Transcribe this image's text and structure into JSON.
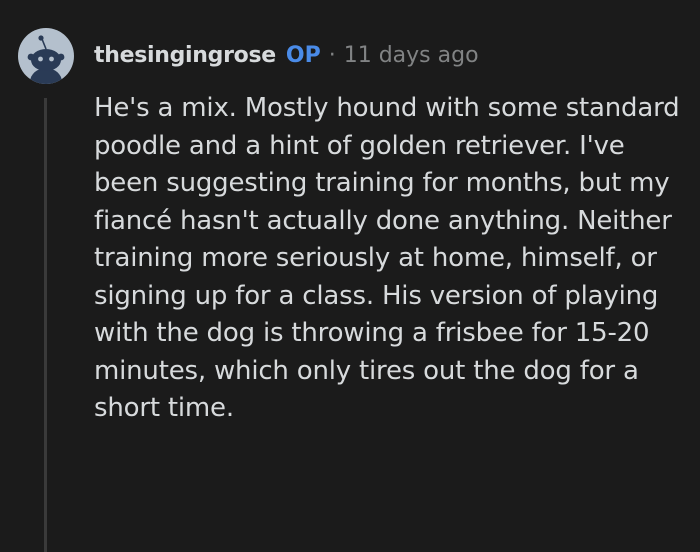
{
  "comment": {
    "avatar_icon": "reddit-snoo-avatar-icon",
    "username": "thesingingrose",
    "op_badge": "OP",
    "separator": "·",
    "timestamp": "11 days ago",
    "body": "He's a mix. Mostly hound with some standard poodle and a hint of golden retriever. I've been suggesting training for months, but my fiancé hasn't actually done anything. Neither training more seriously at home, himself, or signing up for a class. His version of playing with the dog is throwing a frisbee for 15-20 minutes, which only tires out the dog for a short time."
  },
  "colors": {
    "background": "#1b1b1b",
    "text": "#d7dadc",
    "op_accent": "#4a8be8",
    "muted": "#818384",
    "avatar_bg": "#b4c0cd"
  }
}
